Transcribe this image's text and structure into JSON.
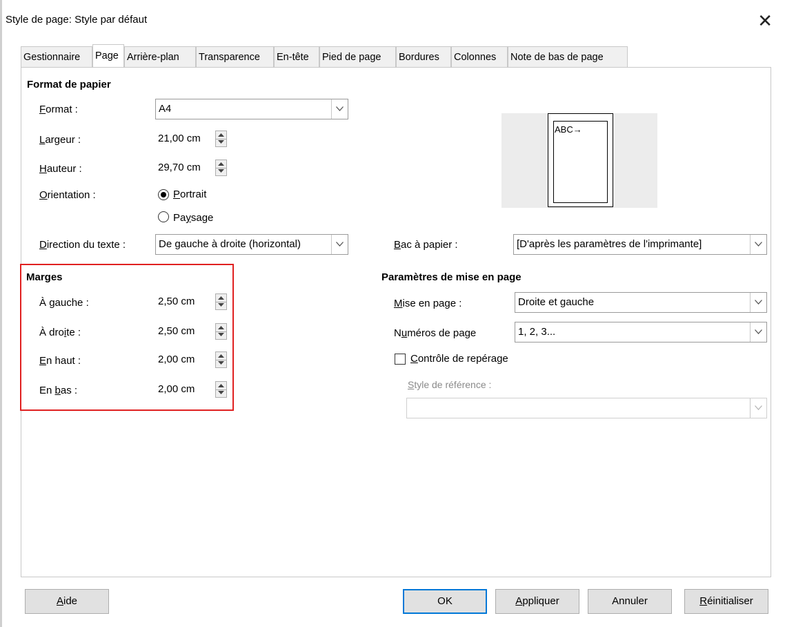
{
  "window": {
    "title": "Style de page: Style par défaut",
    "close_glyph": "✕"
  },
  "tabs": [
    {
      "label": "Gestionnaire",
      "active": false
    },
    {
      "label": "Page",
      "active": true
    },
    {
      "label": "Arrière-plan",
      "active": false
    },
    {
      "label": "Transparence",
      "active": false
    },
    {
      "label": "En-tête",
      "active": false
    },
    {
      "label": "Pied de page",
      "active": false
    },
    {
      "label": "Bordures",
      "active": false
    },
    {
      "label": "Colonnes",
      "active": false
    },
    {
      "label": "Note de bas de page",
      "active": false
    }
  ],
  "paper": {
    "header": "Format de papier",
    "format_label_u": "F",
    "format_label_rest": "ormat :",
    "format_value": "A4",
    "width_label_u": "L",
    "width_label_rest": "argeur :",
    "width_value": "21,00 cm",
    "height_label_u": "H",
    "height_label_rest": "auteur :",
    "height_value": "29,70 cm",
    "orientation_label_u": "O",
    "orientation_label_rest": "rientation :",
    "portrait_u": "P",
    "portrait_rest": "ortrait",
    "landscape_pre": "Pa",
    "landscape_u": "y",
    "landscape_rest": "sage",
    "direction_label_u": "D",
    "direction_label_rest": "irection du texte :",
    "direction_value": "De gauche à droite (horizontal)",
    "tray_label_u": "B",
    "tray_label_rest": "ac à papier :",
    "tray_value": "[D'après les paramètres de l'imprimante]",
    "preview_text": "ABC→"
  },
  "margins": {
    "header": "Marges",
    "left_pre": "À ",
    "left_u": "g",
    "left_rest": "auche :",
    "left_value": "2,50 cm",
    "right_pre": "À dro",
    "right_u": "i",
    "right_rest": "te :",
    "right_value": "2,50 cm",
    "top_u": "E",
    "top_rest": "n haut :",
    "top_value": "2,00 cm",
    "bottom_pre": "En ",
    "bottom_u": "b",
    "bottom_rest": "as :",
    "bottom_value": "2,00 cm"
  },
  "layout": {
    "header": "Paramètres de mise en page",
    "layout_label_u": "M",
    "layout_label_rest": "ise en page :",
    "layout_value": "Droite et gauche",
    "numbers_pre": "N",
    "numbers_u": "u",
    "numbers_rest": "méros de page",
    "numbers_value": "1, 2, 3...",
    "register_u": "C",
    "register_rest": "ontrôle de repérage",
    "ref_style_u": "S",
    "ref_style_rest": "tyle de référence :"
  },
  "buttons": {
    "help_u": "A",
    "help_rest": "ide",
    "ok": "OK",
    "apply_u": "A",
    "apply_rest": "ppliquer",
    "cancel": "Annuler",
    "reset_u": "R",
    "reset_rest": "éinitialiser"
  }
}
